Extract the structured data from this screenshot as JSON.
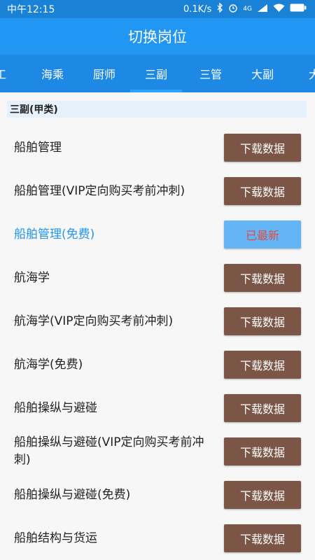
{
  "status": {
    "time": "中午12:15",
    "speed": "0.1K/s",
    "network": "4G",
    "icons": [
      "bluetooth-icon",
      "alarm-icon",
      "signal-icon",
      "wifi-icon",
      "battery-icon"
    ]
  },
  "appbar": {
    "title": "切换岗位"
  },
  "tabs": [
    {
      "label": "工"
    },
    {
      "label": "海乘"
    },
    {
      "label": "厨师"
    },
    {
      "label": "三副",
      "active": true
    },
    {
      "label": "三管"
    },
    {
      "label": "大副"
    },
    {
      "label": "大"
    }
  ],
  "section": {
    "title": "三副(甲类)"
  },
  "items": [
    {
      "label": "船舶管理",
      "button": "下载数据"
    },
    {
      "label": "船舶管理(VIP定向购买考前冲刺)",
      "button": "下载数据"
    },
    {
      "label": "船舶管理(免费)",
      "button": "已最新",
      "highlight": true
    },
    {
      "label": "航海学",
      "button": "下载数据"
    },
    {
      "label": "航海学(VIP定向购买考前冲刺)",
      "button": "下载数据"
    },
    {
      "label": "航海学(免费)",
      "button": "下载数据"
    },
    {
      "label": "船舶操纵与避碰",
      "button": "下载数据"
    },
    {
      "label": "船舶操纵与避碰(VIP定向购买考前冲刺)",
      "button": "下载数据"
    },
    {
      "label": "船舶操纵与避碰(免费)",
      "button": "下载数据"
    },
    {
      "label": "船舶结构与货运",
      "button": "下载数据"
    }
  ],
  "colors": {
    "statusbar": "#1a82d6",
    "appbar": "#2196f3",
    "tabbar": "#1e88e5",
    "button": "#7b5546",
    "button_latest": "#64b5f6",
    "latest_text": "#e34b3f"
  }
}
